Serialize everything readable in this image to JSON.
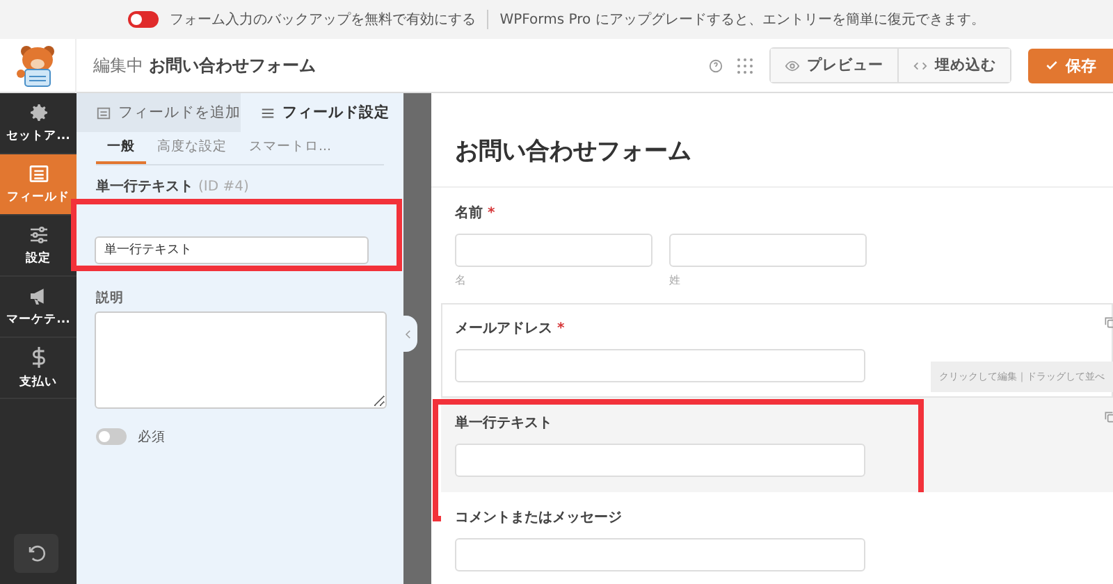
{
  "notice": {
    "toggle_on": false,
    "text": "フォーム入力のバックアップを無料で有効にする",
    "promo": "WPForms Pro にアップグレードすると、エントリーを簡単に復元できます。"
  },
  "header": {
    "editing_label": "編集中",
    "form_name": "お問い合わせフォーム",
    "preview": "プレビュー",
    "embed": "埋め込む",
    "save": "保存"
  },
  "nav": [
    {
      "label": "セットア...",
      "selected": false
    },
    {
      "label": "フィールド",
      "selected": true
    },
    {
      "label": "設定",
      "selected": false
    },
    {
      "label": "マーケテ...",
      "selected": false
    },
    {
      "label": "支払い",
      "selected": false
    }
  ],
  "panel": {
    "tabs": [
      {
        "label": "フィールドを追加",
        "selected": false
      },
      {
        "label": "フィールド設定",
        "selected": true
      }
    ],
    "subtabs": [
      {
        "label": "一般",
        "selected": true
      },
      {
        "label": "高度な設定",
        "selected": false
      },
      {
        "label": "スマートロ...",
        "selected": false
      }
    ],
    "field_title": "単一行テキスト",
    "field_id": "(ID #4)",
    "label_field": {
      "value": "単一行テキスト",
      "highlighted": true
    },
    "description_label": "説明",
    "required": {
      "label": "必須",
      "on": false
    }
  },
  "form": {
    "title": "お問い合わせフォーム",
    "fields": [
      {
        "kind": "name",
        "label": "名前",
        "required_mark": "*",
        "sublabels": [
          "名",
          "姓"
        ],
        "highlighted": false,
        "framed": false
      },
      {
        "kind": "text",
        "label": "メールアドレス",
        "required_mark": "*",
        "highlighted": false,
        "framed": true
      },
      {
        "kind": "text",
        "label": "単一行テキスト",
        "highlighted": true,
        "framed": false
      },
      {
        "kind": "text",
        "label": "コメントまたはメッセージ",
        "highlighted": false,
        "framed": false
      }
    ],
    "tooltip": "クリックして編集｜ドラッグして並べ"
  }
}
